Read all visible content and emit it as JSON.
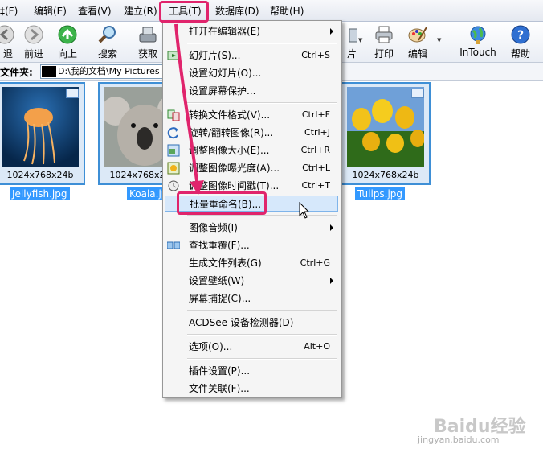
{
  "menubar": {
    "items": [
      "‡(F)",
      "编辑(E)",
      "查看(V)",
      "建立(R)",
      "工具(T)",
      "数据库(D)",
      "帮助(H)"
    ]
  },
  "toolbar": {
    "buttons": [
      {
        "label": "退",
        "icon": "back-arrow-icon"
      },
      {
        "label": "前进",
        "icon": "forward-arrow-icon"
      },
      {
        "label": "向上",
        "icon": "up-arrow-icon"
      },
      {
        "label": "搜索",
        "icon": "search-icon"
      },
      {
        "label": "获取",
        "icon": "acquire-icon"
      },
      {
        "label": "片",
        "icon": "slideshow-icon"
      },
      {
        "label": "打印",
        "icon": "printer-icon"
      },
      {
        "label": "编辑",
        "icon": "palette-icon"
      },
      {
        "label": "InTouch",
        "icon": "globe-icon"
      },
      {
        "label": "帮助",
        "icon": "help-icon"
      }
    ]
  },
  "folder": {
    "label": "文件夹:",
    "path": "D:\\我的文档\\My Pictures"
  },
  "thumbnails": [
    {
      "name": "Jellyfish.jpg",
      "dims": "1024x768x24b"
    },
    {
      "name": "Koala.jpg",
      "dims": "1024x768x24b"
    },
    {
      "name": "Tulips.jpg",
      "dims": "1024x768x24b"
    }
  ],
  "menu": {
    "items": [
      {
        "label": "打开在编辑器(E)",
        "shortcut": "",
        "submenu": true
      },
      {
        "label": "幻灯片(S)...",
        "shortcut": "Ctrl+S"
      },
      {
        "label": "设置幻灯片(O)..."
      },
      {
        "label": "设置屏幕保护..."
      },
      {
        "label": "转换文件格式(V)...",
        "shortcut": "Ctrl+F"
      },
      {
        "label": "旋转/翻转图像(R)...",
        "shortcut": "Ctrl+J"
      },
      {
        "label": "调整图像大小(E)...",
        "shortcut": "Ctrl+R"
      },
      {
        "label": "调整图像曝光度(A)...",
        "shortcut": "Ctrl+L"
      },
      {
        "label": "调整图像时间戳(T)...",
        "shortcut": "Ctrl+T"
      },
      {
        "label": "批量重命名(B)..."
      },
      {
        "label": "图像音频(I)",
        "submenu": true
      },
      {
        "label": "查找重覆(F)..."
      },
      {
        "label": "生成文件列表(G)",
        "shortcut": "Ctrl+G"
      },
      {
        "label": "设置壁纸(W)",
        "submenu": true
      },
      {
        "label": "屏幕捕捉(C)..."
      },
      {
        "label": "ACDSee 设备检测器(D)"
      },
      {
        "label": "选项(O)...",
        "shortcut": "Alt+O"
      },
      {
        "label": "插件设置(P)..."
      },
      {
        "label": "文件关联(F)..."
      }
    ]
  },
  "colors": {
    "annotation": "#e0246c",
    "selection": "#3399ff",
    "highlight": "#d6e8fb"
  },
  "watermark": {
    "text": "Baidu经验",
    "url": "jingyan.baidu.com"
  }
}
